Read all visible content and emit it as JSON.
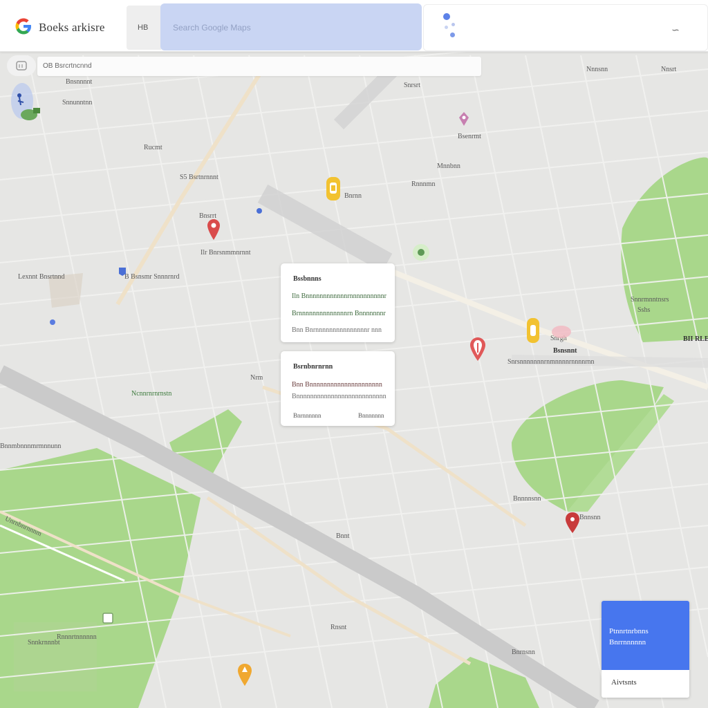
{
  "app": {
    "title": "Boeks arkisre",
    "side_tab_label": "HB",
    "search_placeholder": "Search Google Maps",
    "location_field_text": "OB Bsrcrtncnnd"
  },
  "colors": {
    "search_bg": "#c9d5f3",
    "park_green": "#a8d88a",
    "road_gray": "#c8c8c8",
    "accent_blue": "#4776ee",
    "pin_red": "#d94b4b",
    "pin_yellow": "#f2c230",
    "pin_orange": "#f0a830"
  },
  "map": {
    "labels": [
      "Snrsrt",
      "Rucmt",
      "S5 Bsrtnrnnnt",
      "Bnsrrt",
      "Ilr Bnrsnmmnrnnt",
      "Lexnnt Bnsrtnnd",
      "B Bsnsmr Snnnrnrd",
      "Ncnnrnrnrnstn",
      "Bnnmbnnnmrmnnunn",
      "Nrm",
      "Unrnbnrnnnm",
      "Rnnnrtnnnnnn",
      "Snnkrnnnbt",
      "Rnsnt",
      "Bnnt",
      "Nnnsnn",
      "Nnsrt",
      "Bsenrmt",
      "Mnnbnn",
      "Snnrmnntnsrs",
      "Sshs",
      "Snrgh",
      "Bsnsnnt",
      "BII RLE",
      "Snrsnnnnnnnrnmnnnnrnnnnrnn",
      "Bnnsnn",
      "Bnnnnsnn",
      "Bnrnn",
      "Snnunntnn",
      "Bnsnnnnt",
      "Rnnnmn",
      "Bnrnsnn"
    ]
  },
  "cards": [
    {
      "title": "Bssbnnns",
      "lines": [
        "Iln Bnnnnnnnnnnnnrnnnnnnnnnnr",
        "Brnnnnnnnnnnnnnnrn Bnnnnnnnr",
        "Bnn Bnrnnnnnnnnnnnnnnnr nnn"
      ]
    },
    {
      "title": "Bsrnbnrnrnn",
      "lines": [
        "Bnn Bnnnnnnnnnnnnnnnnnnnnn",
        "Bnnnnnnnnnnnnnnnnnnnnnnnnnn"
      ],
      "button_left": "Bnrnnnnnn",
      "button_right": "Bnnnnnnn"
    }
  ],
  "action_panel": {
    "line1": "Ptnnrtnrbnns",
    "line2": "Bnrrnnnnnn",
    "button": "Aivtsnts"
  },
  "icons": [
    "google-g-logo",
    "menu-icon",
    "person-icon",
    "map-pin-red",
    "map-pin-yellow",
    "map-pin-orange",
    "map-pin-blue",
    "transit-icon",
    "warning-icon"
  ]
}
